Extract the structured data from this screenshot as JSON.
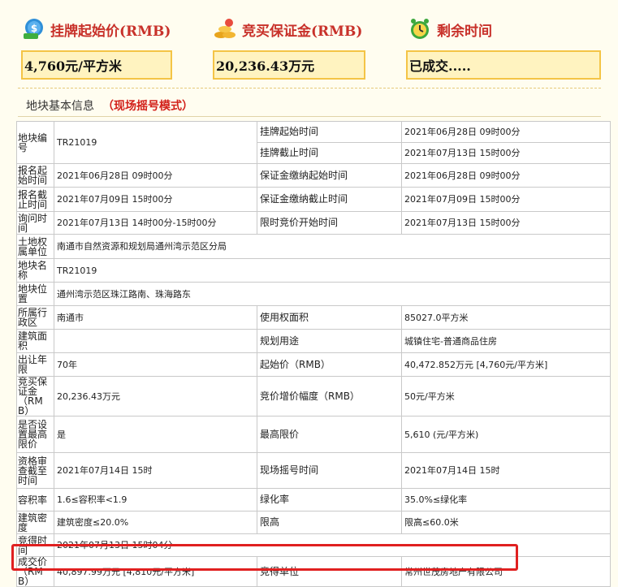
{
  "header": {
    "price_label": "挂牌起始价(RMB)",
    "price_value": "4,760元/平方米",
    "deposit_label": "竞买保证金(RMB)",
    "deposit_value": "20,236.43万元",
    "time_label": "剩余时间",
    "time_value": "已成交....."
  },
  "section": {
    "title": "地块基本信息",
    "mode": "（现场摇号模式）"
  },
  "colors": {
    "title_red": "#c8312a",
    "box_fill": "#fff3c0",
    "box_border": "#f4c446",
    "highlight": "#e02020"
  },
  "icons": [
    "money-coin-icon",
    "gold-ingots-icon",
    "alarm-clock-icon"
  ],
  "rows": {
    "r1": {
      "k1": "地块编号",
      "v1": "TR21019",
      "k2a": "挂牌起始时间",
      "v2a": "2021年06月28日 09时00分",
      "k2b": "挂牌截止时间",
      "v2b": "2021年07月13日 15时00分"
    },
    "r2": {
      "k1": "报名起始时间",
      "v1": "2021年06月28日 09时00分",
      "k2": "保证金缴纳起始时间",
      "v2": "2021年06月28日 09时00分"
    },
    "r3": {
      "k1": "报名截止时间",
      "v1": "2021年07月09日 15时00分",
      "k2": "保证金缴纳截止时间",
      "v2": "2021年07月09日 15时00分"
    },
    "r4": {
      "k1": "询问时间",
      "v1": "2021年07月13日 14时00分-15时00分",
      "k2": "限时竞价开始时间",
      "v2": "2021年07月13日 15时00分"
    },
    "r5": {
      "k1": "土地权属单位",
      "v1": "南通市自然资源和规划局通州湾示范区分局"
    },
    "r6": {
      "k1": "地块名称",
      "v1": "TR21019"
    },
    "r7": {
      "k1": "地块位置",
      "v1": "通州湾示范区珠江路南、珠海路东"
    },
    "r8": {
      "k1": "所属行政区",
      "v1": "南通市",
      "k2": "使用权面积",
      "v2": "85027.0平方米"
    },
    "r9": {
      "k1": "建筑面积",
      "v1": "",
      "k2": "规划用途",
      "v2": "城镇住宅-普通商品住房"
    },
    "r10": {
      "k1": "出让年限",
      "v1": "70年",
      "k2": "起始价（RMB）",
      "v2": "40,472.852万元 [4,760元/平方米]"
    },
    "r11": {
      "k1": "竞买保证金（RMB）",
      "v1": "20,236.43万元",
      "k2": "竞价增价幅度（RMB）",
      "v2": "50元/平方米"
    },
    "r12": {
      "k1": "是否设置最高限价",
      "v1": "是",
      "k2": "最高限价",
      "v2": "5,610 (元/平方米)"
    },
    "r13": {
      "k1": "资格审查截至时间",
      "v1": "2021年07月14日 15时",
      "k2": "现场摇号时间",
      "v2": "2021年07月14日 15时"
    },
    "r14": {
      "k1": "容积率",
      "v1": "1.6≤容积率<1.9",
      "k2": "绿化率",
      "v2": "35.0%≤绿化率"
    },
    "r15": {
      "k1": "建筑密度",
      "v1": "建筑密度≤20.0%",
      "k2": "限高",
      "v2": "限高≤60.0米"
    },
    "r16": {
      "k1": "竞得时间",
      "v1": "2021年07月13日 15时04分"
    },
    "r17": {
      "k1": "成交价（RMB）",
      "v1": "40,897.99万元 [4,810元/平方米]",
      "k2": "竞得单位",
      "v2": "常州世茂房地产有限公司"
    }
  }
}
